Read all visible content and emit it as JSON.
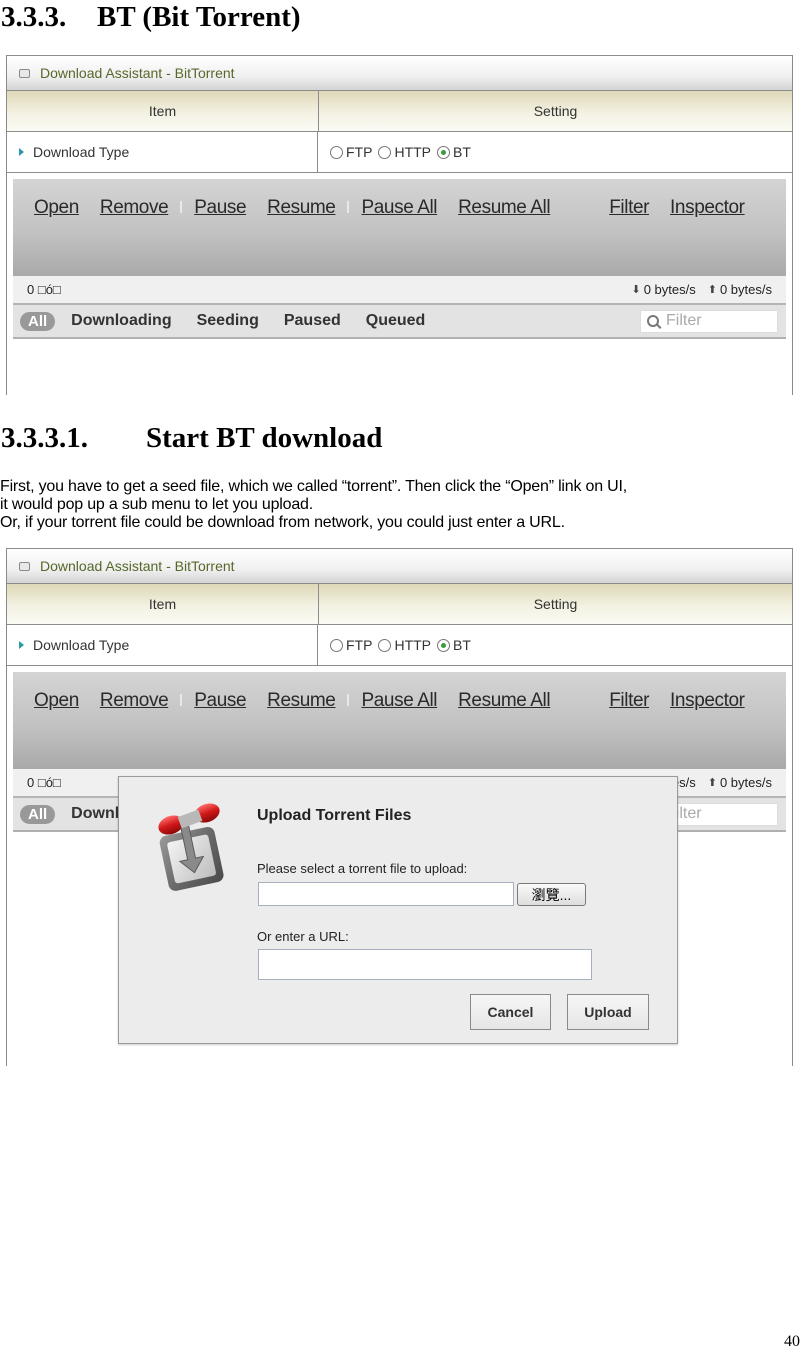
{
  "section_heading": {
    "number": "3.3.3.",
    "title": "BT (Bit Torrent)"
  },
  "subsection_heading": {
    "number": "3.3.3.1.",
    "title": "Start BT download"
  },
  "paragraph": [
    "First, you have to get a seed file, which we called “torrent”. Then click the “Open” link on UI,",
    "it would pop up a sub menu to let you upload.",
    "Or, if your torrent file could be download from network, you could just enter a URL."
  ],
  "page_number": "40",
  "panel": {
    "title": "Download Assistant - BitTorrent",
    "col_item": "Item",
    "col_setting": "Setting",
    "row_label": "Download Type",
    "radio_options": [
      {
        "label": "FTP",
        "selected": false
      },
      {
        "label": "HTTP",
        "selected": false
      },
      {
        "label": "BT",
        "selected": true
      }
    ]
  },
  "toolbar": {
    "open": "Open",
    "remove": "Remove",
    "pause": "Pause",
    "resume": "Resume",
    "pause_all": "Pause All",
    "resume_all": "Resume All",
    "filter": "Filter",
    "inspector": "Inspector"
  },
  "status": {
    "count_text": "0 □ó□",
    "download_rate": "0 bytes/s",
    "upload_rate": "0 bytes/s"
  },
  "filter_tabs": {
    "all": "All",
    "downloading": "Downloading",
    "seeding": "Seeding",
    "paused": "Paused",
    "queued": "Queued",
    "search_placeholder": "Filter"
  },
  "upload_dialog": {
    "title": "Upload Torrent Files",
    "file_label": "Please select a torrent file to upload:",
    "file_value": "",
    "browse_label": "瀏覽...",
    "url_label": "Or enter a URL:",
    "url_value": "",
    "cancel_label": "Cancel",
    "upload_label": "Upload"
  }
}
